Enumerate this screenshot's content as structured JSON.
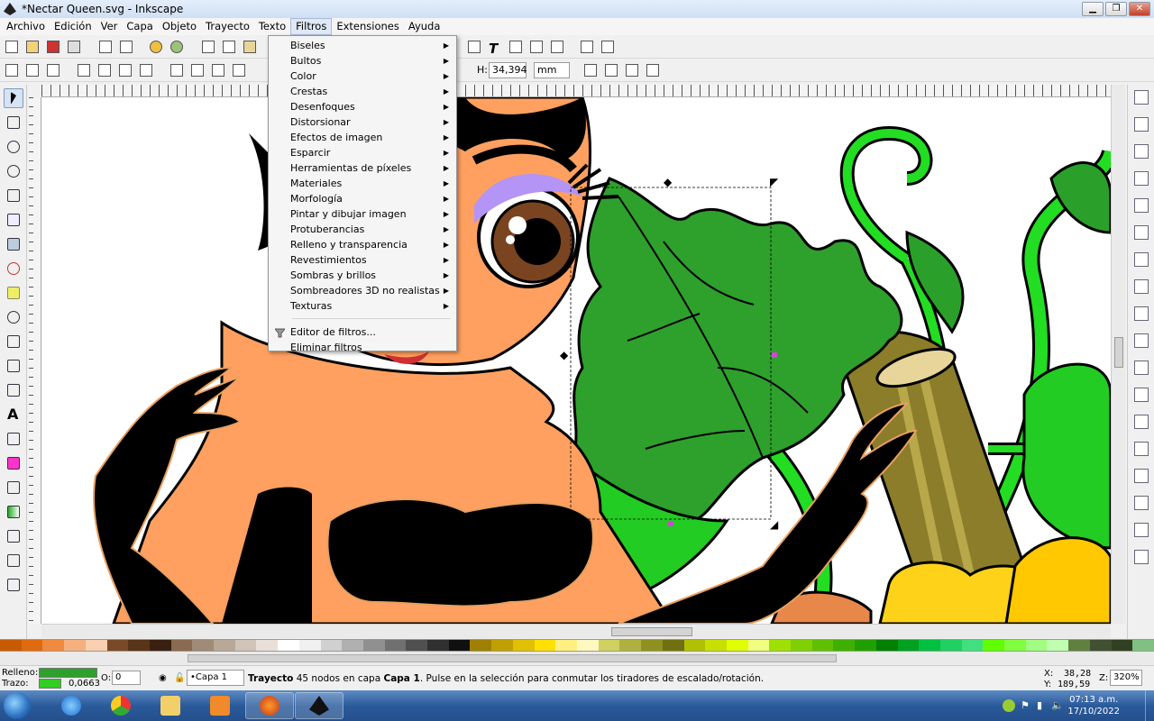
{
  "window": {
    "title": "*Nectar Queen.svg - Inkscape"
  },
  "menubar": {
    "items": [
      "Archivo",
      "Edición",
      "Ver",
      "Capa",
      "Objeto",
      "Trayecto",
      "Texto",
      "Filtros",
      "Extensiones",
      "Ayuda"
    ]
  },
  "filters_menu": {
    "items": [
      {
        "label": "Biseles",
        "submenu": true
      },
      {
        "label": "Bultos",
        "submenu": true
      },
      {
        "label": "Color",
        "submenu": true
      },
      {
        "label": "Crestas",
        "submenu": true
      },
      {
        "label": "Desenfoques",
        "submenu": true
      },
      {
        "label": "Distorsionar",
        "submenu": true
      },
      {
        "label": "Efectos de imagen",
        "submenu": true
      },
      {
        "label": "Esparcir",
        "submenu": true
      },
      {
        "label": "Herramientas de píxeles",
        "submenu": true
      },
      {
        "label": "Materiales",
        "submenu": true
      },
      {
        "label": "Morfología",
        "submenu": true
      },
      {
        "label": "Pintar y dibujar imagen",
        "submenu": true
      },
      {
        "label": "Protuberancias",
        "submenu": true
      },
      {
        "label": "Relleno y transparencia",
        "submenu": true
      },
      {
        "label": "Revestimientos",
        "submenu": true
      },
      {
        "label": "Sombras y brillos",
        "submenu": true
      },
      {
        "label": "Sombreadores 3D no realistas",
        "submenu": true
      },
      {
        "label": "Texturas",
        "submenu": true
      }
    ],
    "bottom": [
      {
        "label": "Editor de filtros..."
      },
      {
        "label": "Eliminar filtros"
      }
    ]
  },
  "controls": {
    "h_label": "H:",
    "h_value": "34,394",
    "unit": "mm"
  },
  "status": {
    "fill_label": "Relleno:",
    "stroke_label": "Trazo:",
    "stroke_width": "0,0663",
    "opacity_label": "O:",
    "opacity_value": "0",
    "layer": "•Capa 1",
    "message_bold": "Trayecto",
    "message_rest": " 45 nodos en capa ",
    "message_layer": "Capa 1",
    "message_end": ". Pulse en la selección para conmutar los tiradores de escalado/rotación.",
    "x_label": "X:",
    "x_value": "38,28",
    "y_label": "Y:",
    "y_value": "189,59",
    "z_label": "Z:",
    "zoom": "320%",
    "fill_color": "#2ea02c",
    "stroke_color": "#33cc22"
  },
  "taskbar": {
    "time": "07:13 a.m.",
    "date": "17/10/2022"
  },
  "icons": {
    "menu_editor": "filter-icon"
  }
}
